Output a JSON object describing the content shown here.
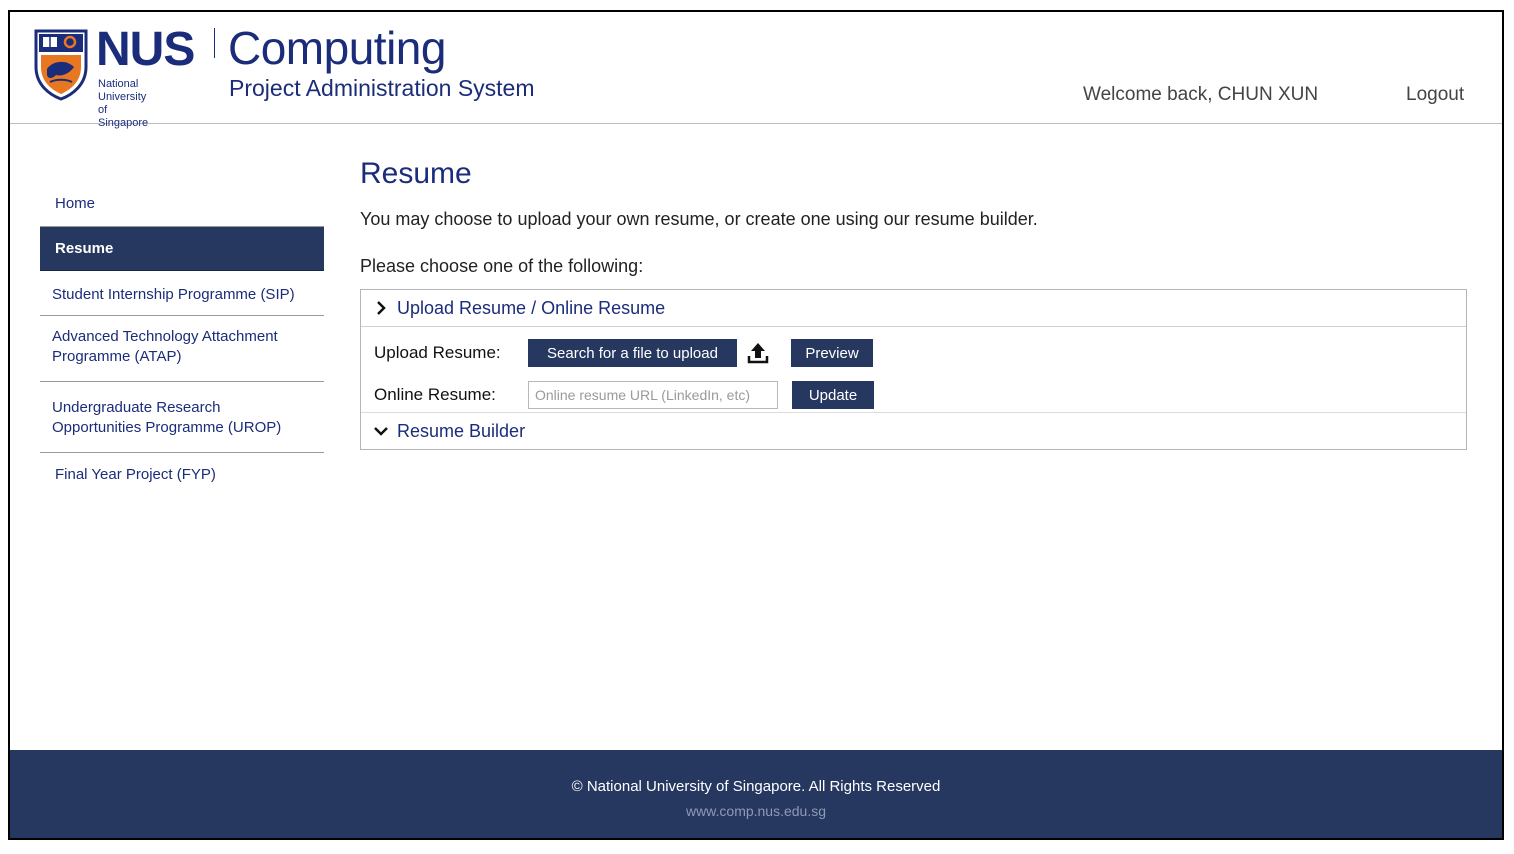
{
  "header": {
    "brand_nus": "NUS",
    "brand_nus_sub": "National University\nof Singapore",
    "brand_computing": "Computing",
    "subtitle": "Project Administration System",
    "welcome": "Welcome back, CHUN XUN",
    "logout": "Logout"
  },
  "sidebar": {
    "items": [
      {
        "label": "Home"
      },
      {
        "label": "Resume",
        "active": true
      },
      {
        "label": "Student Internship Programme (SIP)"
      },
      {
        "label": "Advanced Technology Attachment Programme (ATAP)"
      },
      {
        "label": "Undergraduate Research Opportunities Programme (UROP)"
      },
      {
        "label": "Final Year Project (FYP)"
      }
    ]
  },
  "main": {
    "title": "Resume",
    "intro": "You may choose to upload your own resume, or create one using our resume builder.",
    "choose": "Please choose one of the following:",
    "panel_upload": {
      "heading": "Upload Resume / Online Resume",
      "upload_label": "Upload Resume:",
      "search_button": "Search for a file to upload",
      "preview_button": "Preview",
      "online_label": "Online Resume:",
      "online_placeholder": "Online resume URL (LinkedIn, etc)",
      "online_value": "",
      "update_button": "Update"
    },
    "panel_builder": {
      "heading": "Resume Builder"
    }
  },
  "footer": {
    "copyright": "© National University of Singapore. All Rights Reserved",
    "site": "www.comp.nus.edu.sg"
  },
  "colors": {
    "navy": "#263760",
    "brand_blue": "#1b2d7a",
    "crest_orange": "#e87722"
  }
}
